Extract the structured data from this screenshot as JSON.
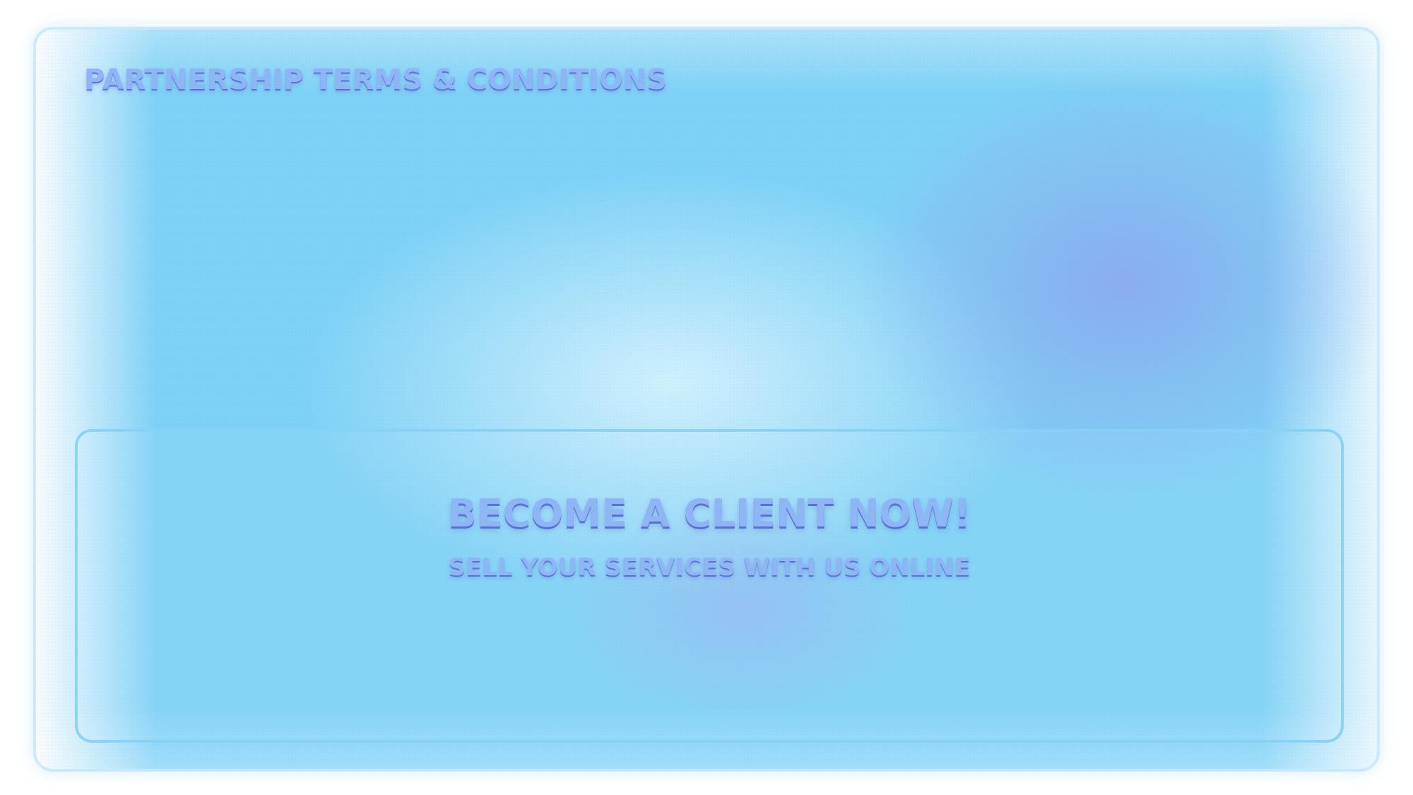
{
  "header": {
    "title": "PARTNERSHIP TERMS & CONDITIONS"
  },
  "cta": {
    "title": "BECOME A CLIENT NOW!",
    "subtitle": "SELL YOUR SERVICES WITH US ONLINE"
  },
  "colors": {
    "background": "#7ed2f6",
    "accent_purple": "#8ea0ec",
    "text_fill": "#8fb6f4",
    "text_shadow": "#5b6fd6",
    "panel_border": "#87d2f5"
  }
}
